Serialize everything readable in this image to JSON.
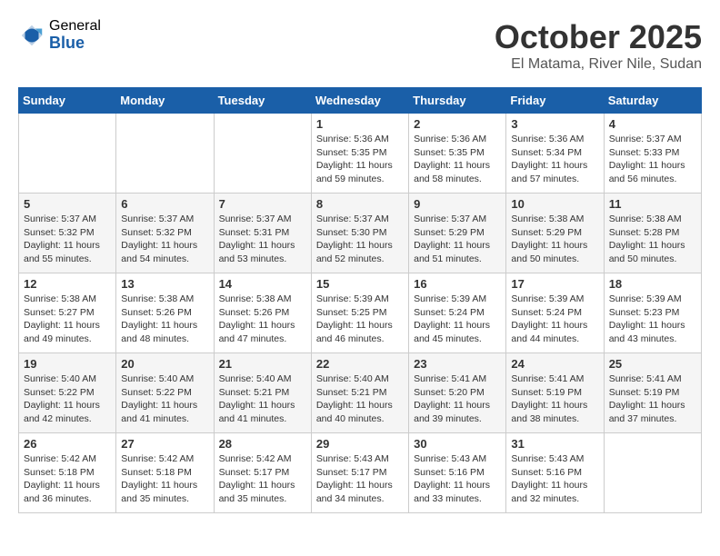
{
  "header": {
    "logo_general": "General",
    "logo_blue": "Blue",
    "month_title": "October 2025",
    "location": "El Matama, River Nile, Sudan"
  },
  "weekdays": [
    "Sunday",
    "Monday",
    "Tuesday",
    "Wednesday",
    "Thursday",
    "Friday",
    "Saturday"
  ],
  "weeks": [
    [
      {
        "day": "",
        "info": ""
      },
      {
        "day": "",
        "info": ""
      },
      {
        "day": "",
        "info": ""
      },
      {
        "day": "1",
        "info": "Sunrise: 5:36 AM\nSunset: 5:35 PM\nDaylight: 11 hours\nand 59 minutes."
      },
      {
        "day": "2",
        "info": "Sunrise: 5:36 AM\nSunset: 5:35 PM\nDaylight: 11 hours\nand 58 minutes."
      },
      {
        "day": "3",
        "info": "Sunrise: 5:36 AM\nSunset: 5:34 PM\nDaylight: 11 hours\nand 57 minutes."
      },
      {
        "day": "4",
        "info": "Sunrise: 5:37 AM\nSunset: 5:33 PM\nDaylight: 11 hours\nand 56 minutes."
      }
    ],
    [
      {
        "day": "5",
        "info": "Sunrise: 5:37 AM\nSunset: 5:32 PM\nDaylight: 11 hours\nand 55 minutes."
      },
      {
        "day": "6",
        "info": "Sunrise: 5:37 AM\nSunset: 5:32 PM\nDaylight: 11 hours\nand 54 minutes."
      },
      {
        "day": "7",
        "info": "Sunrise: 5:37 AM\nSunset: 5:31 PM\nDaylight: 11 hours\nand 53 minutes."
      },
      {
        "day": "8",
        "info": "Sunrise: 5:37 AM\nSunset: 5:30 PM\nDaylight: 11 hours\nand 52 minutes."
      },
      {
        "day": "9",
        "info": "Sunrise: 5:37 AM\nSunset: 5:29 PM\nDaylight: 11 hours\nand 51 minutes."
      },
      {
        "day": "10",
        "info": "Sunrise: 5:38 AM\nSunset: 5:29 PM\nDaylight: 11 hours\nand 50 minutes."
      },
      {
        "day": "11",
        "info": "Sunrise: 5:38 AM\nSunset: 5:28 PM\nDaylight: 11 hours\nand 50 minutes."
      }
    ],
    [
      {
        "day": "12",
        "info": "Sunrise: 5:38 AM\nSunset: 5:27 PM\nDaylight: 11 hours\nand 49 minutes."
      },
      {
        "day": "13",
        "info": "Sunrise: 5:38 AM\nSunset: 5:26 PM\nDaylight: 11 hours\nand 48 minutes."
      },
      {
        "day": "14",
        "info": "Sunrise: 5:38 AM\nSunset: 5:26 PM\nDaylight: 11 hours\nand 47 minutes."
      },
      {
        "day": "15",
        "info": "Sunrise: 5:39 AM\nSunset: 5:25 PM\nDaylight: 11 hours\nand 46 minutes."
      },
      {
        "day": "16",
        "info": "Sunrise: 5:39 AM\nSunset: 5:24 PM\nDaylight: 11 hours\nand 45 minutes."
      },
      {
        "day": "17",
        "info": "Sunrise: 5:39 AM\nSunset: 5:24 PM\nDaylight: 11 hours\nand 44 minutes."
      },
      {
        "day": "18",
        "info": "Sunrise: 5:39 AM\nSunset: 5:23 PM\nDaylight: 11 hours\nand 43 minutes."
      }
    ],
    [
      {
        "day": "19",
        "info": "Sunrise: 5:40 AM\nSunset: 5:22 PM\nDaylight: 11 hours\nand 42 minutes."
      },
      {
        "day": "20",
        "info": "Sunrise: 5:40 AM\nSunset: 5:22 PM\nDaylight: 11 hours\nand 41 minutes."
      },
      {
        "day": "21",
        "info": "Sunrise: 5:40 AM\nSunset: 5:21 PM\nDaylight: 11 hours\nand 41 minutes."
      },
      {
        "day": "22",
        "info": "Sunrise: 5:40 AM\nSunset: 5:21 PM\nDaylight: 11 hours\nand 40 minutes."
      },
      {
        "day": "23",
        "info": "Sunrise: 5:41 AM\nSunset: 5:20 PM\nDaylight: 11 hours\nand 39 minutes."
      },
      {
        "day": "24",
        "info": "Sunrise: 5:41 AM\nSunset: 5:19 PM\nDaylight: 11 hours\nand 38 minutes."
      },
      {
        "day": "25",
        "info": "Sunrise: 5:41 AM\nSunset: 5:19 PM\nDaylight: 11 hours\nand 37 minutes."
      }
    ],
    [
      {
        "day": "26",
        "info": "Sunrise: 5:42 AM\nSunset: 5:18 PM\nDaylight: 11 hours\nand 36 minutes."
      },
      {
        "day": "27",
        "info": "Sunrise: 5:42 AM\nSunset: 5:18 PM\nDaylight: 11 hours\nand 35 minutes."
      },
      {
        "day": "28",
        "info": "Sunrise: 5:42 AM\nSunset: 5:17 PM\nDaylight: 11 hours\nand 35 minutes."
      },
      {
        "day": "29",
        "info": "Sunrise: 5:43 AM\nSunset: 5:17 PM\nDaylight: 11 hours\nand 34 minutes."
      },
      {
        "day": "30",
        "info": "Sunrise: 5:43 AM\nSunset: 5:16 PM\nDaylight: 11 hours\nand 33 minutes."
      },
      {
        "day": "31",
        "info": "Sunrise: 5:43 AM\nSunset: 5:16 PM\nDaylight: 11 hours\nand 32 minutes."
      },
      {
        "day": "",
        "info": ""
      }
    ]
  ]
}
